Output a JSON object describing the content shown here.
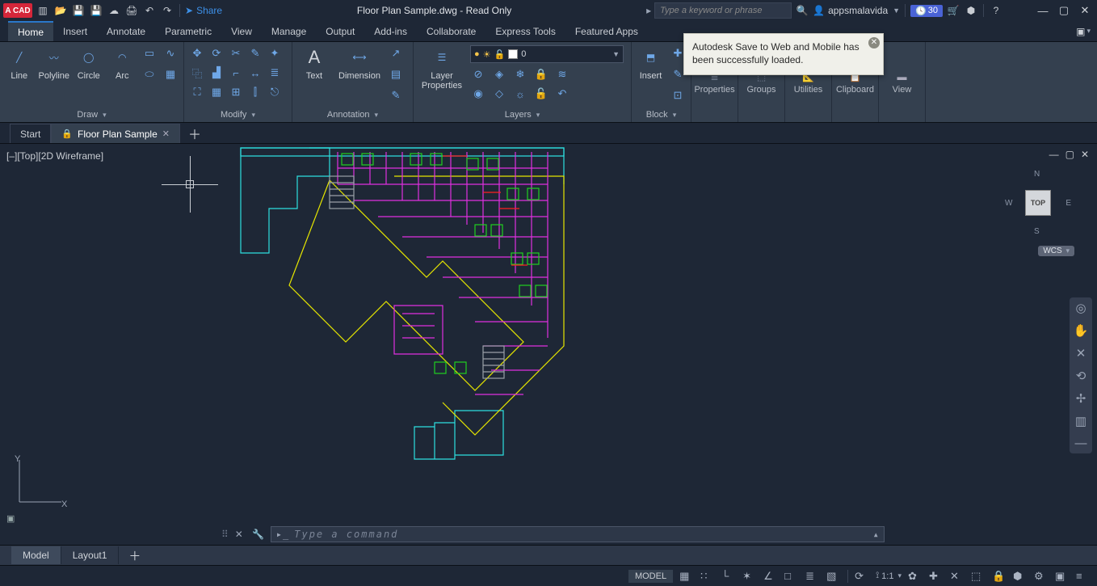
{
  "app": {
    "logo": "A CAD",
    "title": "Floor Plan Sample.dwg - Read Only"
  },
  "qat": {
    "share": "Share"
  },
  "search": {
    "placeholder": "Type a keyword or phrase"
  },
  "user": {
    "name": "appsmalavida",
    "days_badge": "30"
  },
  "ribbon_tabs": [
    "Home",
    "Insert",
    "Annotate",
    "Parametric",
    "View",
    "Manage",
    "Output",
    "Add-ins",
    "Collaborate",
    "Express Tools",
    "Featured Apps"
  ],
  "ribbon": {
    "draw": {
      "title": "Draw",
      "line": "Line",
      "polyline": "Polyline",
      "circle": "Circle",
      "arc": "Arc"
    },
    "modify": {
      "title": "Modify"
    },
    "annotation": {
      "title": "Annotation",
      "text": "Text",
      "dimension": "Dimension"
    },
    "layers": {
      "title": "Layers",
      "props": "Layer Properties",
      "current": "0"
    },
    "block": {
      "title": "Block",
      "insert": "Insert"
    },
    "properties": "Properties",
    "groups": "Groups",
    "utilities": "Utilities",
    "clipboard": "Clipboard",
    "view": "View"
  },
  "toast": {
    "text": "Autodesk Save to Web and Mobile has been successfully loaded."
  },
  "filetabs": {
    "start": "Start",
    "doc": "Floor Plan Sample"
  },
  "viewport": {
    "label": "[–][Top][2D Wireframe]",
    "cube": "TOP",
    "wcs": "WCS",
    "n": "N",
    "s": "S",
    "e": "E",
    "w": "W"
  },
  "command": {
    "placeholder": "Type a command"
  },
  "layouts": {
    "model": "Model",
    "layout1": "Layout1"
  },
  "status": {
    "model": "MODEL",
    "scale": "1:1"
  }
}
